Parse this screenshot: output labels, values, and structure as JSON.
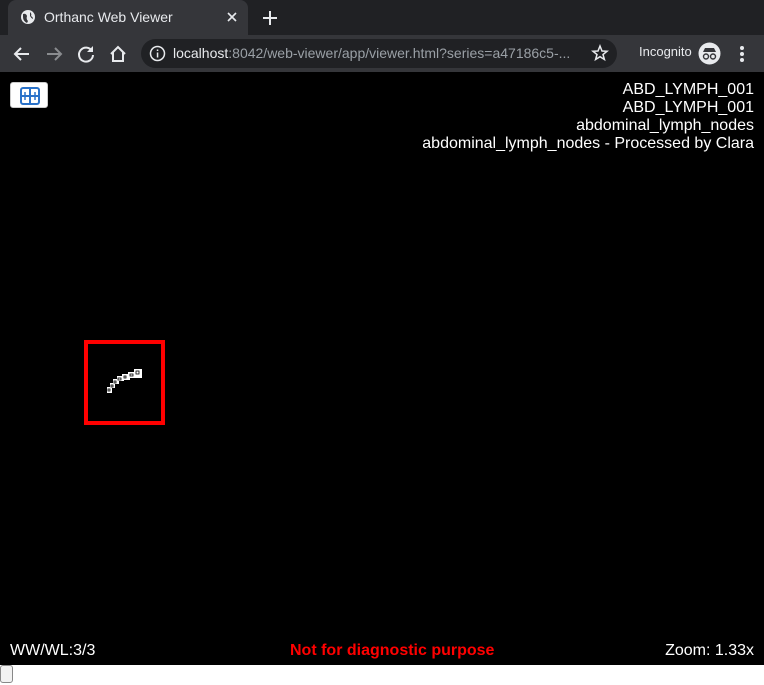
{
  "browser": {
    "tab": {
      "title": "Orthanc Web Viewer"
    },
    "address": {
      "host": "localhost",
      "rest": ":8042/web-viewer/app/viewer.html?series=a47186c5-..."
    },
    "incognito_label": "Incognito",
    "icons": [
      "globe-icon",
      "close-icon",
      "plus-icon",
      "back-icon",
      "forward-icon",
      "reload-icon",
      "home-icon",
      "info-icon",
      "star-icon",
      "incognito-icon",
      "menu-icon"
    ]
  },
  "viewer": {
    "patient_info": [
      "ABD_LYMPH_001",
      "ABD_LYMPH_001",
      "abdominal_lymph_nodes",
      "abdominal_lymph_nodes - Processed by Clara"
    ],
    "ww_wl": "WW/WL:3/3",
    "warning": "Not for diagnostic purpose",
    "zoom": "Zoom: 1.33x",
    "slice_position": 0,
    "colors": {
      "background": "#000000",
      "roi": "#ff0000",
      "warning": "#ff0000"
    }
  }
}
